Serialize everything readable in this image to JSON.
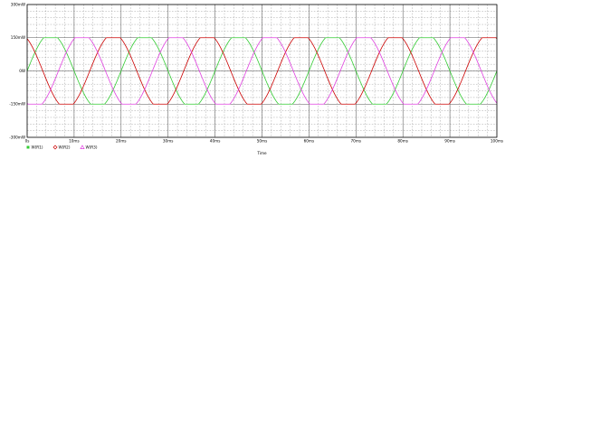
{
  "chart_data": {
    "type": "line",
    "xlabel": "Time",
    "ylabel": "",
    "xlim": [
      0,
      100
    ],
    "ylim": [
      -300,
      300
    ],
    "x_unit": "ms",
    "x_ticks": [
      0,
      10,
      20,
      30,
      40,
      50,
      60,
      70,
      80,
      90,
      100
    ],
    "x_tick_labels": [
      "0s",
      "10ms",
      "20ms",
      "30ms",
      "40ms",
      "50ms",
      "60ms",
      "70ms",
      "80ms",
      "90ms",
      "100ms"
    ],
    "y_ticks": [
      -300,
      -150,
      0,
      150,
      300
    ],
    "y_tick_labels": [
      "-300mW",
      "-150mW",
      "0W",
      "150mW",
      "300mW"
    ],
    "grid": true,
    "legend_position": "bottom-left",
    "period_ms": 20,
    "peak": 150,
    "series": [
      {
        "name": "W(R1)",
        "color": "#33cc33",
        "marker": "square",
        "phase_deg": 0,
        "x": [
          0,
          2.5,
          5,
          7.5,
          10,
          12.5,
          15,
          17.5,
          20
        ],
        "values": [
          0,
          140,
          150,
          140,
          0,
          -140,
          -150,
          -140,
          0
        ]
      },
      {
        "name": "W(R2)",
        "color": "#cc0000",
        "marker": "diamond",
        "phase_deg": 120,
        "x": [
          0,
          2.5,
          5,
          7.5,
          10,
          12.5,
          15,
          17.5,
          20
        ],
        "values": [
          130,
          45,
          -75,
          -148,
          -130,
          -45,
          75,
          148,
          130
        ]
      },
      {
        "name": "W(R3)",
        "color": "#e040e0",
        "marker": "triangle",
        "phase_deg": -120,
        "x": [
          0,
          2.5,
          5,
          7.5,
          10,
          12.5,
          15,
          17.5,
          20
        ],
        "values": [
          -130,
          -148,
          -75,
          45,
          130,
          148,
          75,
          -45,
          -130
        ]
      }
    ]
  }
}
